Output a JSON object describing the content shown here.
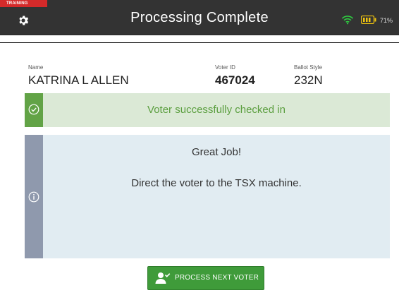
{
  "header": {
    "mode_tag": "TRAINING",
    "title": "Processing Complete",
    "battery_percent": "71%",
    "settings_icon": "gear-icon",
    "wifi_icon": "wifi-icon",
    "battery_icon": "battery-icon"
  },
  "voter": {
    "name_label": "Name",
    "name_value": "KATRINA L ALLEN",
    "voter_id_label": "Voter ID",
    "voter_id_value": "467024",
    "ballot_style_label": "Ballot Style",
    "ballot_style_value": "232N"
  },
  "success_banner": {
    "message": "Voter successfully checked in",
    "icon": "check-circle-icon"
  },
  "info_panel": {
    "heading": "Great Job!",
    "body": "Direct the voter to the TSX machine.",
    "icon": "info-icon"
  },
  "actions": {
    "next_label": "PROCESS NEXT VOTER",
    "next_icon": "user-check-icon"
  },
  "colors": {
    "header_bg": "#333333",
    "training_tag": "#d42a2a",
    "success_stripe": "#62a346",
    "success_bg": "#dbe9d6",
    "success_text": "#5a9e3e",
    "info_stripe": "#8f99ad",
    "info_bg": "#e1ecf2",
    "button_bg": "#3f9b3a",
    "wifi": "#2ecc40",
    "battery": "#f1c40f"
  }
}
